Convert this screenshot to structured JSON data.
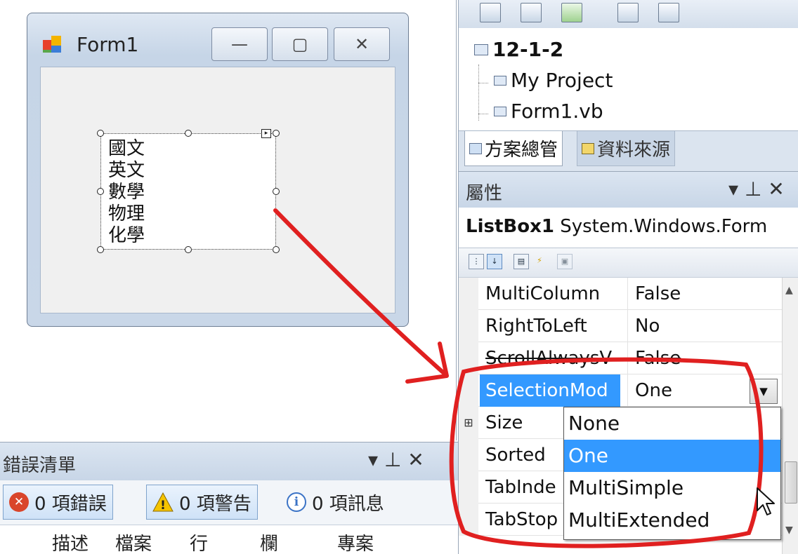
{
  "form_window": {
    "title": "Form1",
    "min_glyph": "—",
    "max_glyph": "▢",
    "close_glyph": "✕"
  },
  "listbox": {
    "items": [
      "國文",
      "英文",
      "數學",
      "物理",
      "化學"
    ],
    "smart_tag_glyph": "▸"
  },
  "solution_explorer": {
    "project": "12-1-2",
    "children": [
      "My Project",
      "Form1.vb"
    ],
    "tabs": [
      "方案總管",
      "資料來源"
    ]
  },
  "properties": {
    "title": "屬性",
    "object_name": "ListBox1",
    "object_type": "System.Windows.Form",
    "pin_glyph": "▾ ⊥ ✕",
    "rows": [
      {
        "name": "MultiColumn",
        "value": "False"
      },
      {
        "name": "RightToLeft",
        "value": "No"
      },
      {
        "name": "ScrollAlwaysV",
        "value": "False"
      },
      {
        "name": "SelectionMod",
        "value": "One"
      },
      {
        "name": "Size",
        "value": ""
      },
      {
        "name": "Sorted",
        "value": ""
      },
      {
        "name": "TabInde",
        "value": ""
      },
      {
        "name": "TabStop",
        "value": ""
      }
    ],
    "size_expander": "⊞",
    "dropdown_arrow": "▼",
    "selection_options": [
      "None",
      "One",
      "MultiSimple",
      "MultiExtended"
    ],
    "selected_option": "One"
  },
  "error_list": {
    "title": "錯誤清單",
    "errors": "0 項錯誤",
    "warnings": "0 項警告",
    "messages": "0 項訊息",
    "error_glyph": "✕",
    "warning_glyph": "!",
    "info_glyph": "i",
    "columns": [
      "描述",
      "檔案",
      "行",
      "欄",
      "專案"
    ],
    "pane_glyphs": "▾ ⊥ ✕"
  },
  "colors": {
    "selection_blue": "#3399ff",
    "annotation_red": "#e02020"
  }
}
